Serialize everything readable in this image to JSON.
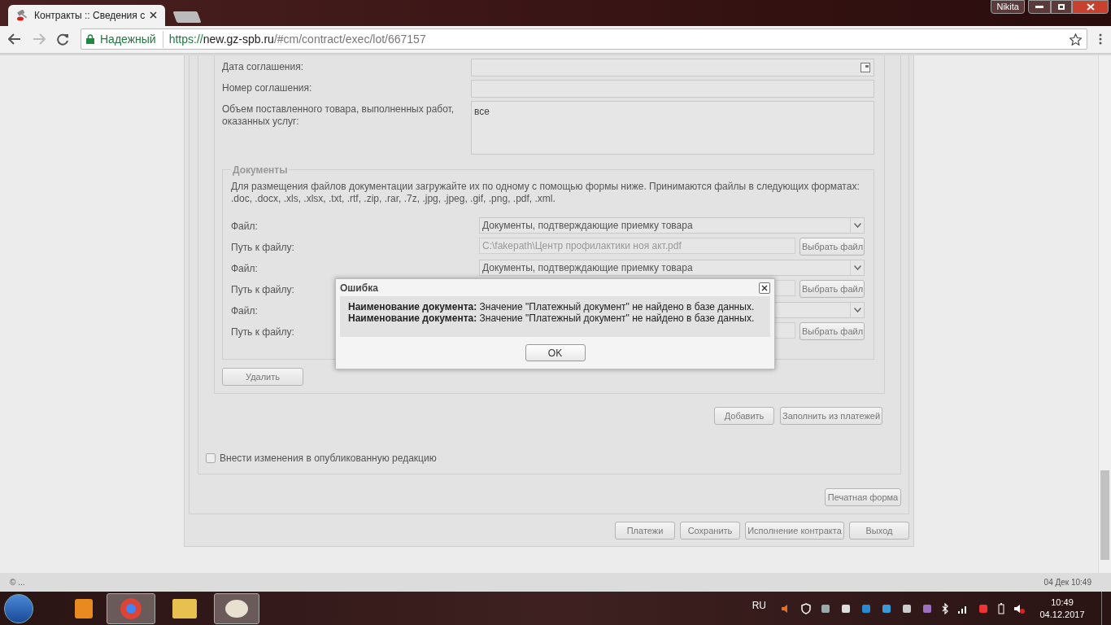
{
  "browser": {
    "tab_title": "Контракты :: Сведения с",
    "user": "Nikita",
    "secure_label": "Надежный",
    "url": {
      "scheme": "https://",
      "host": "new.gz-spb.ru",
      "path": "/#cm/contract/exec/lot/667157"
    }
  },
  "form": {
    "fields": [
      {
        "kind": "date",
        "label": "Дата соглашения:"
      },
      {
        "kind": "text",
        "label": "Номер соглашения:"
      },
      {
        "kind": "textarea",
        "label": "Объем поставленного товара, выполненных работ, оказанных услуг:",
        "value": "все"
      }
    ]
  },
  "documents": {
    "legend": "Документы",
    "note": "Для размещения файлов документации загружайте их по одному с помощью формы ниже. Принимаются файлы в следующих форматах: .doc, .docx, .xls, .xlsx, .txt, .rtf, .zip, .rar, .7z, .jpg, .jpeg, .gif, .png, .pdf, .xml.",
    "rows": [
      {
        "kind": "select",
        "label": "Файл:",
        "value": "Документы, подтверждающие приемку товара"
      },
      {
        "kind": "file",
        "label": "Путь к файлу:",
        "value": "C:\\fakepath\\Центр профилактики ноя акт.pdf",
        "button": "Выбрать файл"
      },
      {
        "kind": "select",
        "label": "Файл:",
        "value": "Документы, подтверждающие приемку товара"
      },
      {
        "kind": "file",
        "label": "Путь к файлу:",
        "button": "Выбрать файл"
      },
      {
        "kind": "select",
        "label": "Файл:"
      },
      {
        "kind": "file",
        "label": "Путь к файлу:",
        "button": "Выбрать файл"
      }
    ],
    "delete_button": "Удалить"
  },
  "actions": {
    "add": "Добавить",
    "fill": "Заполнить из платежей"
  },
  "publish_checkbox": {
    "label": "Внести изменения в опубликованную редакцию",
    "checked": false
  },
  "print_button": "Печатная форма",
  "bottom_buttons": [
    "Платежи",
    "Сохранить",
    "Исполнение контракта",
    "Выход"
  ],
  "status": {
    "left": "© ...",
    "right": "04 Дек 10:49"
  },
  "dialog": {
    "title": "Ошибка",
    "messages": [
      "**Наименование документа:** Значение \"Платежный документ\" не найдено в базе данных.",
      "**Наименование документа:** Значение \"Платежный документ\" не найдено в базе данных."
    ],
    "ok": "OK"
  },
  "taskbar": {
    "language": "RU",
    "time": "10:49",
    "date": "04.12.2017"
  }
}
